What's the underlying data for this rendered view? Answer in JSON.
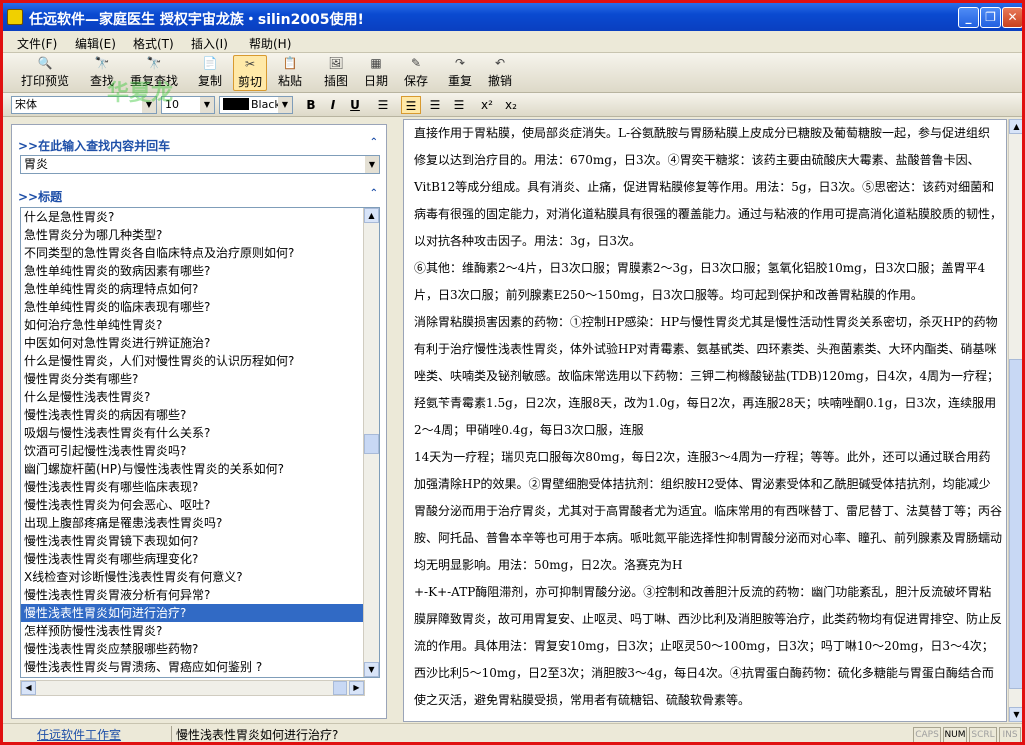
{
  "window": {
    "title": "任远软件—家庭医生   授权宇宙龙族・silin2005使用!",
    "min_label": "_",
    "max_label": "❐",
    "close_label": "✕"
  },
  "menu": [
    "文件(F)",
    "编辑(E)",
    "格式(T)",
    "插入(I)",
    "帮助(H)"
  ],
  "toolbar": [
    {
      "label": "打印预览",
      "icon": "🔍"
    },
    {
      "label": "查找",
      "icon": "🔭"
    },
    {
      "label": "重复查找",
      "icon": "🔭"
    },
    {
      "label": "复制",
      "icon": "📄"
    },
    {
      "label": "剪切",
      "icon": "✂"
    },
    {
      "label": "粘贴",
      "icon": "📋"
    },
    {
      "label": "插图",
      "icon": "🖼"
    },
    {
      "label": "日期",
      "icon": "▦"
    },
    {
      "label": "保存",
      "icon": "✎"
    },
    {
      "label": "重复",
      "icon": "↷"
    },
    {
      "label": "撤销",
      "icon": "↶"
    }
  ],
  "watermark": "华夏龙",
  "format": {
    "font": "宋体",
    "size": "10",
    "color_name": "Black",
    "color": "#000000",
    "bold": "B",
    "italic": "I",
    "underline": "U",
    "superscript": "x²",
    "subscript": "x₂"
  },
  "search": {
    "heading": ">>在此输入查找内容并回车",
    "value": "胃炎"
  },
  "titles": {
    "heading": ">>标题",
    "selected_index": 22,
    "items": [
      "什么是急性胃炎?",
      "急性胃炎分为哪几种类型?",
      "不同类型的急性胃炎各自临床特点及治疗原则如何?",
      "急性单纯性胃炎的致病因素有哪些?",
      "急性单纯性胃炎的病理特点如何?",
      "急性单纯性胃炎的临床表现有哪些?",
      "如何治疗急性单纯性胃炎?",
      "中医如何对急性胃炎进行辨证施治?",
      "什么是慢性胃炎，人们对慢性胃炎的认识历程如何?",
      "慢性胃炎分类有哪些?",
      "什么是慢性浅表性胃炎?",
      "慢性浅表性胃炎的病因有哪些?",
      "吸烟与慢性浅表性胃炎有什么关系?",
      "饮酒可引起慢性浅表性胃炎吗?",
      "幽门螺旋杆菌(HP)与慢性浅表性胃炎的关系如何?",
      "慢性浅表性胃炎有哪些临床表现?",
      "慢性浅表性胃炎为何会恶心、呕吐?",
      "出现上腹部疼痛是罹患浅表性胃炎吗?",
      "慢性浅表性胃炎胃镜下表现如何?",
      "慢性浅表性胃炎有哪些病理变化?",
      "X线检查对诊断慢性浅表性胃炎有何意义?",
      "慢性浅表性胃炎胃液分析有何异常?",
      "慢性浅表性胃炎如何进行治疗?",
      "怎样预防慢性浅表性胃炎?",
      "慢性浅表性胃炎应禁服哪些药物?",
      "慢性浅表性胃炎与胃溃疡、胃癌应如何鉴别 ?"
    ]
  },
  "article": [
    "直接作用于胃粘膜，使局部炎症消失。L-谷氨酰胺与胃肠粘膜上皮成分已糖胺及葡萄糖胺一起，参与促进组织修复以达到治疗目的。用法：670mg，日3次。④胃奕干糖浆：该药主要由硫酸庆大霉素、盐酸普鲁卡因、VitB12等成分组成。具有消炎、止痛，促进胃粘膜修复等作用。用法：5g，日3次。⑤思密达：该药对细菌和病毒有很强的固定能力，对消化道粘膜具有很强的覆盖能力。通过与粘液的作用可提高消化道粘膜胶质的韧性，以对抗各种攻击因子。用法：3g，日3次。",
    "⑥其他：维酶素2～4片，日3次口服；胃膜素2～3g，日3次口服；氢氧化铝胶10mg，日3次口服；盖胃平4片，日3次口服；前列腺素E250～150mg，日3次口服等。均可起到保护和改善胃粘膜的作用。",
    "消除胃粘膜损害因素的药物：①控制HP感染：HP与慢性胃炎尤其是慢性活动性胃炎关系密切，杀灭HP的药物有利于治疗慢性浅表性胃炎，体外试验HP对青霉素、氨基甙类、四环素类、头孢菌素类、大环内酯类、硝基咪唑类、呋喃类及铋剂敏感。故临床常选用以下药物：三钾二枸橼酸铋盐(TDB)120mg，日4次，4周为一疗程；羟氨苄青霉素1.5g，日2次，连服8天，改为1.0g，每日2次，再连服28天；呋喃唑酮0.1g，日3次，连续服用2～4周；甲硝唑0.4g，每日3次口服，连服",
    "14天为一疗程；瑞贝克口服每次80mg，每日2次，连服3～4周为一疗程；等等。此外，还可以通过联合用药加强清除HP的效果。②胃壁细胞受体拮抗剂：组织胺H2受体、胃泌素受体和乙酰胆碱受体拮抗剂，均能减少胃酸分泌而用于治疗胃炎，尤其对于高胃酸者尤为适宜。临床常用的有西咪替丁、雷尼替丁、法莫替丁等；丙谷胺、阿托品、普鲁本辛等也可用于本病。哌吡氮平能选择性抑制胃酸分泌而对心率、瞳孔、前列腺素及胃肠蠕动均无明显影响。用法：50mg，日2次。洛赛克为H",
    "+-K+-ATP酶阻滞剂，亦可抑制胃酸分泌。③控制和改善胆汁反流的药物：幽门功能紊乱，胆汁反流破坏胃粘膜屏障致胃炎，故可用胃复安、止呕灵、吗丁啉、西沙比利及消胆胺等治疗，此类药物均有促进胃排空、防止反流的作用。具体用法：胃复安10mg，日3次；止呕灵50～100mg，日3次；吗丁啉10～20mg，日3～4次；西沙比利5～10mg，日2至3次；消胆胺3～4g，每日4次。④抗胃蛋白酶药物：硫化多糖能与胃蛋白酶结合而使之灭活，避免胃粘膜受损，常用者有硫糖铝、硫酸软骨素等。"
  ],
  "status": {
    "company": "任远软件工作室",
    "current": "慢性浅表性胃炎如何进行治疗?",
    "keys": [
      "CAPS",
      "NUM",
      "SCRL",
      "INS"
    ],
    "keys_on": [
      "NUM"
    ]
  }
}
